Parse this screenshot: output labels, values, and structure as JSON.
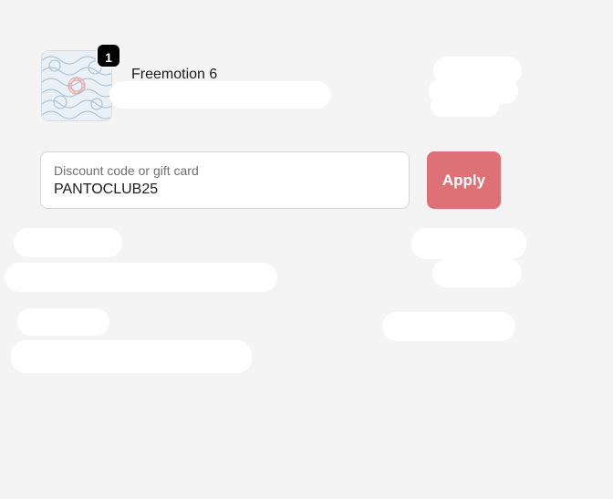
{
  "cart": {
    "item": {
      "name": "Freemotion 6",
      "quantity": "1",
      "thumbnail_icon": "pantograph-pattern-thumbnail"
    }
  },
  "discount": {
    "label": "Discount code or gift card",
    "value": "PANTOCLUB25",
    "apply_label": "Apply"
  },
  "colors": {
    "background": "#f4f4f4",
    "apply_button": "#de7176",
    "badge": "#000000"
  }
}
